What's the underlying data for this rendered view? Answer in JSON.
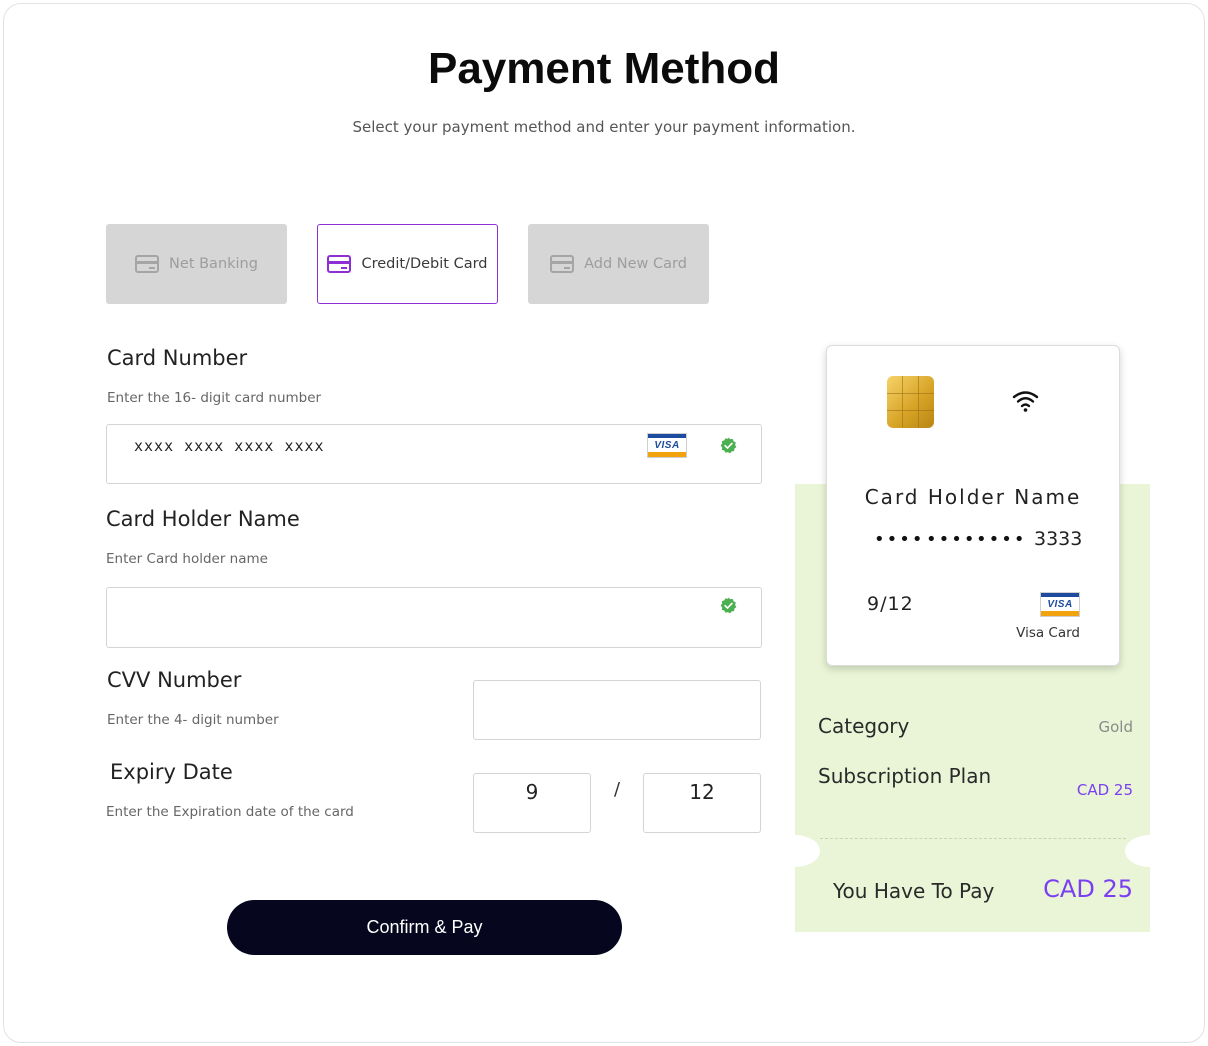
{
  "page": {
    "title": "Payment Method",
    "subtitle": "Select your payment method and enter your payment information."
  },
  "tabs": [
    {
      "label": "Net Banking",
      "state": "disabled",
      "icon": "credit-card-icon"
    },
    {
      "label": "Credit/Debit Card",
      "state": "active",
      "icon": "credit-card-icon"
    },
    {
      "label": "Add New Card",
      "state": "disabled",
      "icon": "credit-card-icon"
    }
  ],
  "form": {
    "card_number": {
      "label": "Card Number",
      "hint": "Enter the 16- digit card number",
      "value": "xxxx xxxx xxxx xxxx",
      "valid": true
    },
    "holder_name": {
      "label": "Card Holder Name",
      "hint": "Enter Card holder name",
      "value": "",
      "valid": true
    },
    "cvv": {
      "label": "CVV Number",
      "hint": "Enter the 4- digit number",
      "value": ""
    },
    "expiry": {
      "label": "Expiry Date",
      "hint": "Enter the Expiration date of the card",
      "month": "9",
      "separator": "/",
      "year": "12"
    },
    "confirm_label": "Confirm & Pay"
  },
  "card_preview": {
    "holder": "Card Holder Name",
    "masked_groups": [
      "••••",
      "••••",
      "••••"
    ],
    "last4": "3333",
    "expiry": "9/12",
    "brand_text": "VISA",
    "brand_label": "Visa Card"
  },
  "summary": {
    "category_label": "Category",
    "category_value": "Gold",
    "plan_label": "Subscription Plan",
    "plan_value": "CAD 25",
    "total_label": "You Have To Pay",
    "total_value": "CAD 25"
  },
  "colors": {
    "accent": "#8e2fd6",
    "price": "#7b3ff2",
    "valid": "#4caf50",
    "summary_bg": "#e9f5d6",
    "confirm_bg": "#06061e"
  }
}
